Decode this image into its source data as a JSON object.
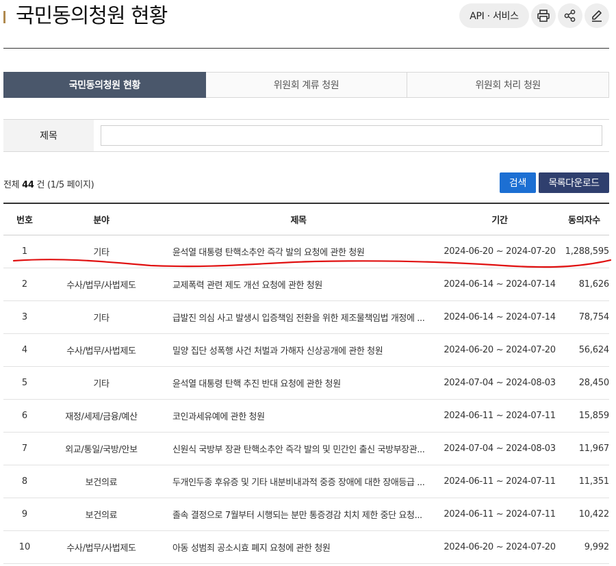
{
  "header": {
    "title": "국민동의청원 현황",
    "api_label": "API · 서비스",
    "icons": [
      "print-icon",
      "share-icon",
      "edit-icon"
    ]
  },
  "tabs": [
    {
      "label": "국민동의청원 현황",
      "active": true
    },
    {
      "label": "위원회 계류 청원",
      "active": false
    },
    {
      "label": "위원회 처리 청원",
      "active": false
    }
  ],
  "search": {
    "label": "제목",
    "value": "",
    "placeholder": ""
  },
  "summary": {
    "prefix": "전체",
    "total": "44",
    "suffix": "건 (1/5 페이지)"
  },
  "buttons": {
    "search": "검색",
    "download": "목록다운로드"
  },
  "table": {
    "columns": [
      "번호",
      "분야",
      "제목",
      "기간",
      "동의자수"
    ],
    "rows": [
      {
        "no": "1",
        "category": "기타",
        "title": "윤석열 대통령 탄핵소추안 즉각 발의 요청에 관한 청원",
        "period": "2024-06-20 ~ 2024-07-20",
        "count": "1,288,595"
      },
      {
        "no": "2",
        "category": "수사/법무/사법제도",
        "title": "교제폭력 관련 제도 개선 요청에 관한 청원",
        "period": "2024-06-14 ~ 2024-07-14",
        "count": "81,626"
      },
      {
        "no": "3",
        "category": "기타",
        "title": "급발진 의심 사고 발생시 입증책임 전환을 위한 제조물책임법 개정에 ...",
        "period": "2024-06-14 ~ 2024-07-14",
        "count": "78,754"
      },
      {
        "no": "4",
        "category": "수사/법무/사법제도",
        "title": "밀양 집단 성폭행 사건 처벌과 가해자 신상공개에 관한 청원",
        "period": "2024-06-20 ~ 2024-07-20",
        "count": "56,624"
      },
      {
        "no": "5",
        "category": "기타",
        "title": "윤석열 대통령 탄핵 추진 반대 요청에 관한 청원",
        "period": "2024-07-04 ~ 2024-08-03",
        "count": "28,450"
      },
      {
        "no": "6",
        "category": "재정/세제/금융/예산",
        "title": "코인과세유예에 관한 청원",
        "period": "2024-06-11 ~ 2024-07-11",
        "count": "15,859"
      },
      {
        "no": "7",
        "category": "외교/통일/국방/안보",
        "title": "신원식 국방부 장관 탄핵소추안 즉각 발의 및 민간인 출신 국방부장관...",
        "period": "2024-07-04 ~ 2024-08-03",
        "count": "11,967"
      },
      {
        "no": "8",
        "category": "보건의료",
        "title": "두개인두종 후유증 및 기타 내분비내과적 중증 장애에 대한 장애등급 ...",
        "period": "2024-06-11 ~ 2024-07-11",
        "count": "11,351"
      },
      {
        "no": "9",
        "category": "보건의료",
        "title": "졸속 결정으로 7월부터 시행되는 분만 통증경감 치치 제한 중단 요청...",
        "period": "2024-06-11 ~ 2024-07-11",
        "count": "10,422"
      },
      {
        "no": "10",
        "category": "수사/법무/사법제도",
        "title": "아동 성범죄 공소시효 폐지 요청에 관한 청원",
        "period": "2024-06-20 ~ 2024-07-20",
        "count": "9,992"
      }
    ]
  },
  "colors": {
    "accent_bar": "#b08a4f",
    "active_tab": "#4a576b",
    "search_button": "#1c6fd3",
    "download_button": "#2f3f6e",
    "annotation_stroke": "#e01010"
  }
}
